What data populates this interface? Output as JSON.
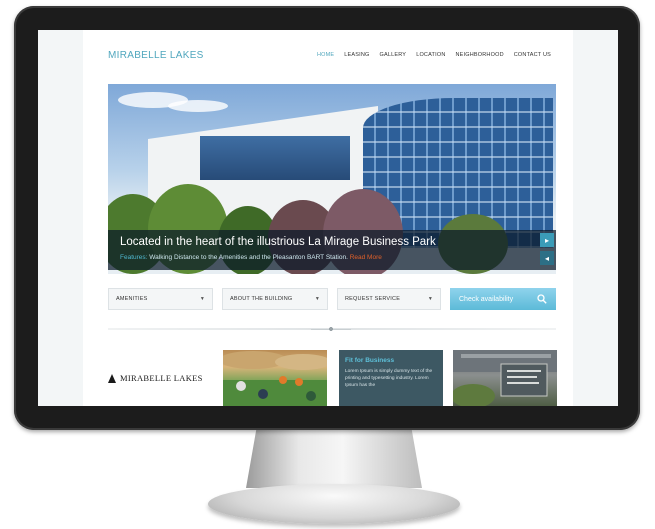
{
  "site": {
    "logo": "MIRABELLE LAKES",
    "nav": [
      "HOME",
      "LEASING",
      "GALLERY",
      "LOCATION",
      "NEIGHBORHOOD",
      "CONTACT US"
    ],
    "active_nav": "HOME"
  },
  "hero": {
    "title": "Located in the heart of the illustrious La Mirage Business Park",
    "feature_label": "Features:",
    "feature_text": "Walking Distance to the Amenities and the Pleasanton BART Station.",
    "read_more": "Read More",
    "next_icon": "chevron-right-icon",
    "prev_icon": "chevron-left-icon"
  },
  "filters": {
    "amenities": "AMENITIES",
    "about": "ABOUT THE BUILDING",
    "request": "REQUEST SERVICE",
    "check": "Check availability",
    "dropdown_icon": "chevron-down-icon",
    "search_icon": "search-icon"
  },
  "cards": {
    "brand": "MIRABELLE LAKES",
    "fit_title": "Fit for Business",
    "fit_body": "Lorem Ipsum is simply dummy text of the printing and typesetting industry. Lorem Ipsum has the"
  },
  "colors": {
    "accent": "#4fa6bd",
    "button": "#5cbad8",
    "read_more": "#e0602a",
    "card_bg": "#3d5863"
  }
}
